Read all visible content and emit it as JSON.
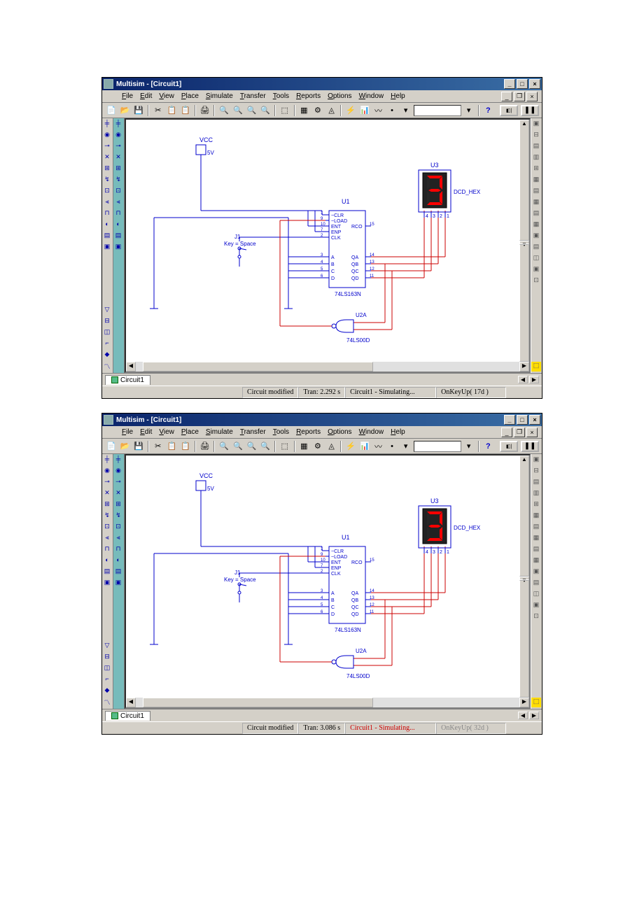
{
  "windows": [
    {
      "title": "Multisim - [Circuit1]",
      "menus": [
        "File",
        "Edit",
        "View",
        "Place",
        "Simulate",
        "Transfer",
        "Tools",
        "Reports",
        "Options",
        "Window",
        "Help"
      ],
      "tab": "Circuit1",
      "status": {
        "modified": "Circuit modified",
        "tran": "Tran: 2.292 s",
        "sim": "Circuit1 - Simulating...",
        "sim_red": false,
        "key": "OnKeyUp( 17d )",
        "key_dim": false
      },
      "display_lit": [
        "a",
        "b",
        "c",
        "d",
        "g"
      ],
      "circuit": {
        "vcc": "VCC",
        "vcc_val": "5V",
        "u1": "U1",
        "u1_part": "74LS163N",
        "u1_pins_left": [
          "~CLR",
          "~LOAD",
          "ENT",
          "ENP",
          "CLK",
          "A",
          "B",
          "C",
          "D"
        ],
        "u1_nums_left": [
          "1",
          "9",
          "10",
          "7",
          "2",
          "3",
          "4",
          "5",
          "6"
        ],
        "u1_pins_right": [
          "RCO",
          "QA",
          "QB",
          "QC",
          "QD"
        ],
        "u1_nums_right": [
          "15",
          "14",
          "13",
          "12",
          "11"
        ],
        "u2": "U2A",
        "u2_part": "74LS00D",
        "u3": "U3",
        "u3_part": "DCD_HEX",
        "u3_pins": [
          "4",
          "3",
          "2",
          "1"
        ],
        "j1": "J1",
        "j1_key": "Key = Space"
      }
    },
    {
      "title": "Multisim - [Circuit1]",
      "menus": [
        "File",
        "Edit",
        "View",
        "Place",
        "Simulate",
        "Transfer",
        "Tools",
        "Reports",
        "Options",
        "Window",
        "Help"
      ],
      "tab": "Circuit1",
      "status": {
        "modified": "Circuit modified",
        "tran": "Tran: 3.086 s",
        "sim": "Circuit1 - Simulating...",
        "sim_red": true,
        "key": "OnKeyUp( 32d )",
        "key_dim": true
      },
      "display_lit": [
        "a",
        "b",
        "c",
        "d",
        "g"
      ],
      "circuit": {
        "vcc": "VCC",
        "vcc_val": "5V",
        "u1": "U1",
        "u1_part": "74LS163N",
        "u1_pins_left": [
          "~CLR",
          "~LOAD",
          "ENT",
          "ENP",
          "CLK",
          "A",
          "B",
          "C",
          "D"
        ],
        "u1_nums_left": [
          "1",
          "9",
          "10",
          "7",
          "2",
          "3",
          "4",
          "5",
          "6"
        ],
        "u1_pins_right": [
          "RCO",
          "QA",
          "QB",
          "QC",
          "QD"
        ],
        "u1_nums_right": [
          "15",
          "14",
          "13",
          "12",
          "11"
        ],
        "u2": "U2A",
        "u2_part": "74LS00D",
        "u3": "U3",
        "u3_part": "DCD_HEX",
        "u3_pins": [
          "4",
          "3",
          "2",
          "1"
        ],
        "j1": "J1",
        "j1_key": "Key = Space"
      }
    }
  ]
}
